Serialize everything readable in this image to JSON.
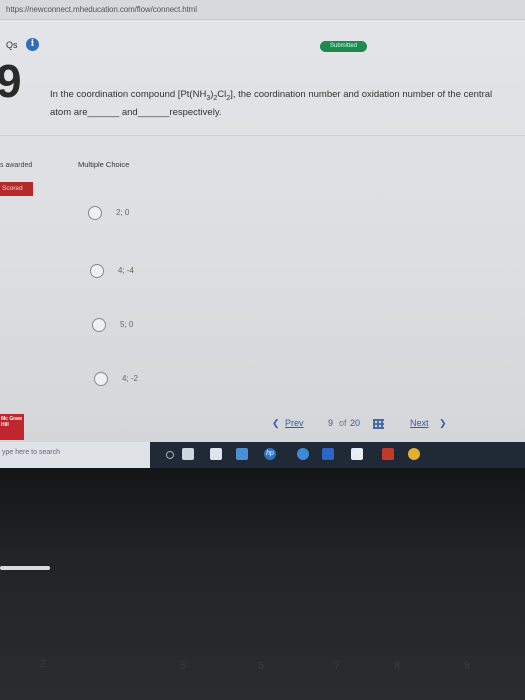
{
  "browser": {
    "url": "https://newconnect.mheducation.com/flow/connect.html"
  },
  "header": {
    "qs_label": "Qs",
    "info_icon": "i",
    "status_badge": "Submitted"
  },
  "question": {
    "number": "9",
    "text_part1": "In the coordination compound [Pt(NH",
    "sub1": "3",
    "text_part2": ")",
    "sub2": "2",
    "text_part3": "Cl",
    "sub3": "2",
    "text_part4": "], the coordination number and oxidation number of the central atom are",
    "blank1": "______",
    "and": "and",
    "blank2": "______",
    "respectively": "respectively."
  },
  "sidebar": {
    "awarded": "s awarded",
    "scored": "Scored"
  },
  "answer": {
    "type_label": "Multiple Choice",
    "options": [
      "2; 0",
      "4; -4",
      "5; 0",
      "4; -2"
    ]
  },
  "pagination": {
    "prev": "Prev",
    "current": "9",
    "of": "of",
    "total": "20",
    "next": "Next"
  },
  "brand": {
    "logo_text": "Mc Graw Hill"
  },
  "taskbar": {
    "search_placeholder": "ype here to search",
    "hp_icon": "hp"
  },
  "keyboard": {
    "keys": [
      "2",
      "5",
      "6",
      "7",
      "8",
      "9"
    ]
  },
  "colors": {
    "accent": "#2f5fa8",
    "submitted": "#1f8a4d",
    "scored": "#b32a2a",
    "brand": "#c0262d"
  }
}
